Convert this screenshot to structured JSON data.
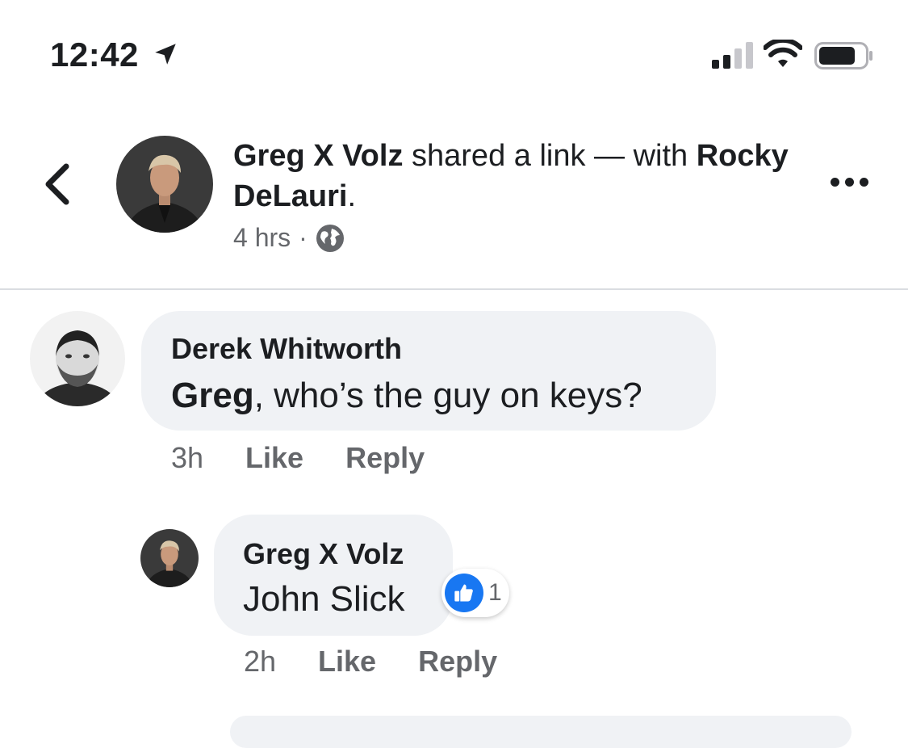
{
  "status_bar": {
    "time": "12:42"
  },
  "post_header": {
    "author": "Greg X Volz",
    "action_text": " shared a link — with ",
    "tagged": "Rocky DeLauri",
    "period": ".",
    "time": "4 hrs",
    "separator": "·"
  },
  "comments": [
    {
      "author": "Derek Whitworth",
      "mention": "Greg",
      "text": ", who’s the guy on keys?",
      "time": "3h",
      "like_label": "Like",
      "reply_label": "Reply"
    },
    {
      "author": "Greg X Volz",
      "text": "John Slick",
      "time": "2h",
      "like_label": "Like",
      "reply_label": "Reply",
      "reaction_count": "1"
    }
  ],
  "colors": {
    "accent": "#1877f2",
    "bubble": "#f0f2f5",
    "muted": "#65676b"
  }
}
